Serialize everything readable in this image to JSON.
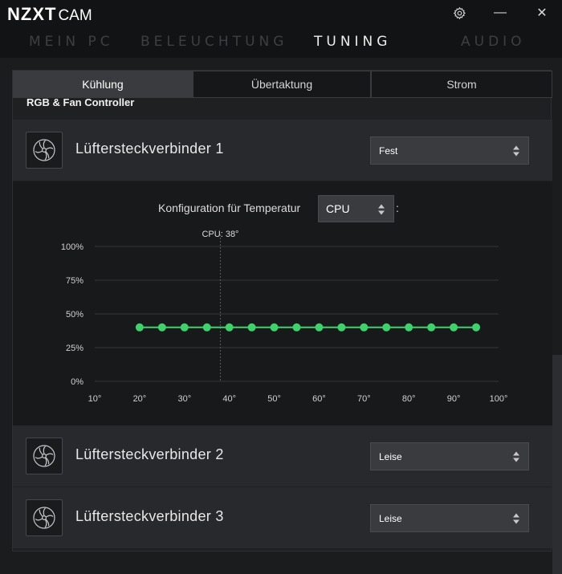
{
  "app": {
    "brand": "NZXT",
    "name": "CAM"
  },
  "window": {
    "settings": "settings",
    "minimize": "—",
    "close": "✕"
  },
  "topnav": [
    {
      "label": "MEIN PC",
      "active": false
    },
    {
      "label": "BELEUCHTUNG",
      "active": false
    },
    {
      "label": "TUNING",
      "active": true
    },
    {
      "label": "AUDIO",
      "active": false
    }
  ],
  "subtabs": [
    {
      "label": "Kühlung",
      "active": true
    },
    {
      "label": "Übertaktung",
      "active": false
    },
    {
      "label": "Strom",
      "active": false
    }
  ],
  "section_title": "RGB & Fan Controller",
  "fans": [
    {
      "label": "Lüftersteckverbinder 1",
      "mode": "Fest"
    },
    {
      "label": "Lüftersteckverbinder 2",
      "mode": "Leise"
    },
    {
      "label": "Lüftersteckverbinder 3",
      "mode": "Leise"
    }
  ],
  "temp_config": {
    "label": "Konfiguration für Temperatur",
    "source": "CPU",
    "suffix": ":"
  },
  "colors": {
    "accent_green": "#3fd16b",
    "grid": "#35363a",
    "axis_text": "#d0d0d0"
  },
  "chart_data": {
    "type": "line",
    "x": [
      20,
      25,
      30,
      35,
      40,
      45,
      50,
      55,
      60,
      65,
      70,
      75,
      80,
      85,
      90,
      95
    ],
    "y": [
      40,
      40,
      40,
      40,
      40,
      40,
      40,
      40,
      40,
      40,
      40,
      40,
      40,
      40,
      40,
      40
    ],
    "xlim": [
      10,
      100
    ],
    "ylim": [
      0,
      100
    ],
    "x_ticks": [
      10,
      20,
      30,
      40,
      50,
      60,
      70,
      80,
      90,
      100
    ],
    "x_tick_labels": [
      "10°",
      "20°",
      "30°",
      "40°",
      "50°",
      "60°",
      "70°",
      "80°",
      "90°",
      "100°"
    ],
    "y_ticks": [
      0,
      25,
      50,
      75,
      100
    ],
    "y_tick_labels": [
      "0%",
      "25%",
      "50%",
      "75%",
      "100%"
    ],
    "current_marker": {
      "x": 38,
      "label": "CPU: 38°"
    },
    "grid": true
  }
}
